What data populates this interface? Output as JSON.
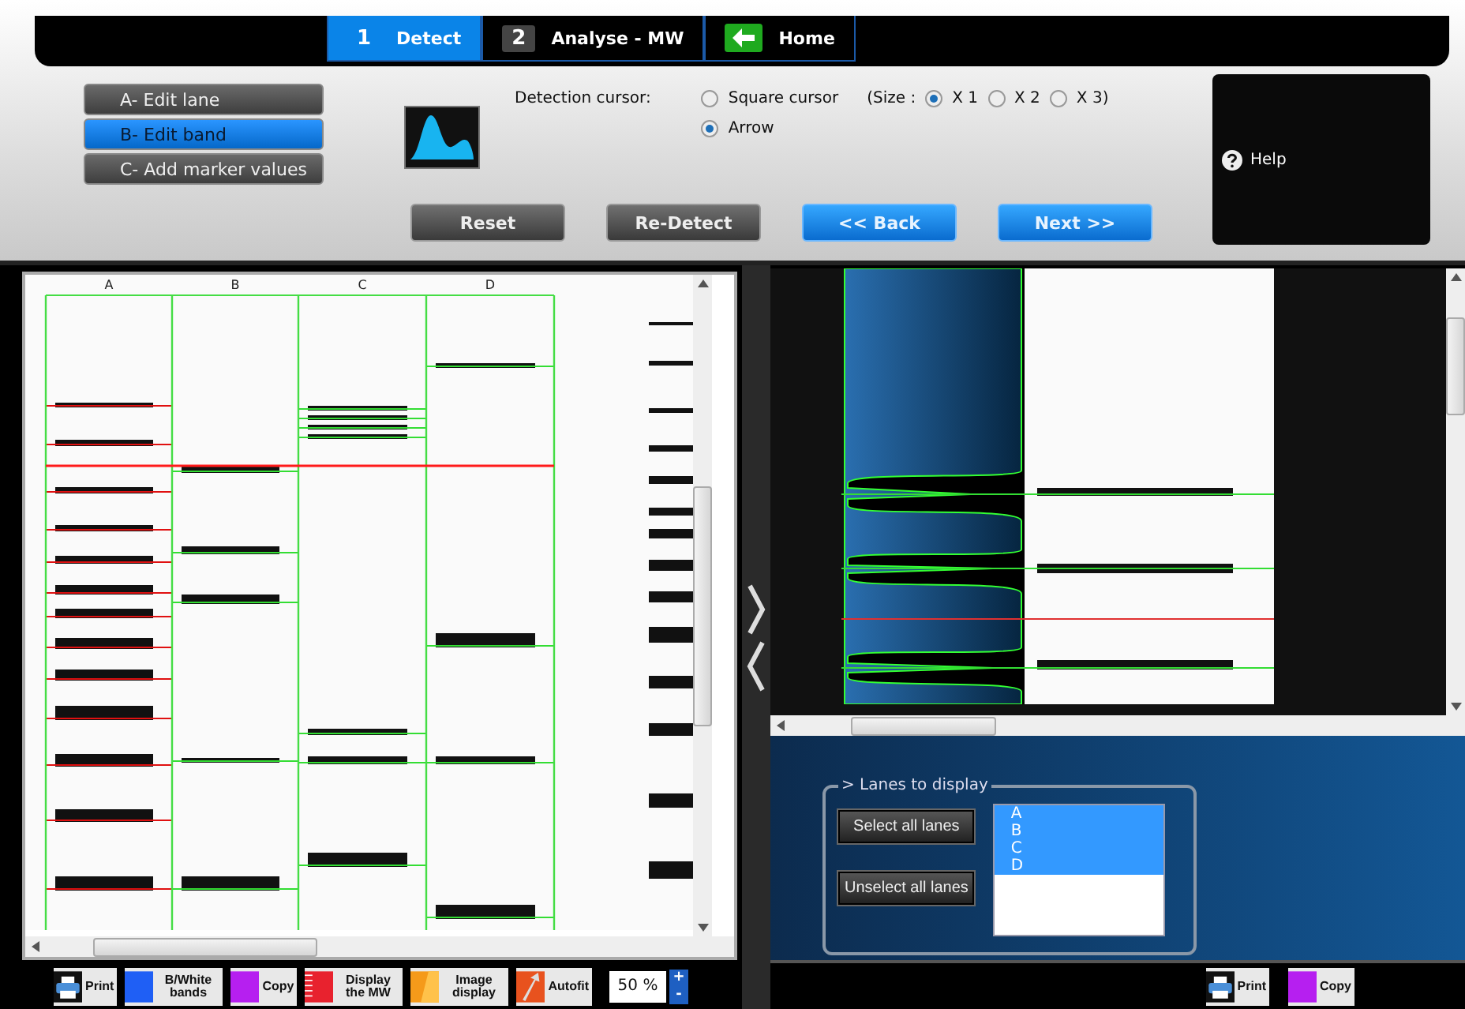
{
  "tabs": [
    {
      "kind": "step",
      "number": "1",
      "label": "Detect",
      "selected": true
    },
    {
      "kind": "step",
      "number": "2",
      "label": "Analyse - MW",
      "selected": false
    },
    {
      "kind": "home",
      "label": "Home",
      "selected": false
    }
  ],
  "modes": [
    {
      "label": "A- Edit lane",
      "selected": false
    },
    {
      "label": "B- Edit band",
      "selected": true
    },
    {
      "label": "C- Add marker values",
      "selected": false
    }
  ],
  "detection": {
    "label": "Detection cursor:",
    "cursors": [
      {
        "label": "Square cursor",
        "selected": false
      },
      {
        "label": "Arrow",
        "selected": true
      }
    ],
    "size_label": "(Size :",
    "sizes": [
      {
        "label": "X 1",
        "selected": true
      },
      {
        "label": "X 2",
        "selected": false
      },
      {
        "label": "X 3)",
        "selected": false
      }
    ]
  },
  "actions": [
    {
      "kind": "gray",
      "label": "Reset"
    },
    {
      "kind": "gray",
      "label": "Re-Detect"
    },
    {
      "kind": "blue",
      "label": "<< Back"
    },
    {
      "kind": "blue",
      "label": "Next >>"
    }
  ],
  "help": "Help",
  "gel": {
    "lanes": [
      "A",
      "B",
      "C",
      "D"
    ]
  },
  "left_toolbar": {
    "tools": [
      {
        "kind": "print",
        "label": "Print"
      },
      {
        "kind": "bw",
        "label": "B/White bands"
      },
      {
        "kind": "copy",
        "label": "Copy"
      },
      {
        "kind": "mw",
        "label": "Display the MW"
      },
      {
        "kind": "image",
        "label": "Image display"
      },
      {
        "kind": "autofit",
        "label": "Autofit"
      }
    ],
    "zoom": "50 %",
    "zoom_in": "+",
    "zoom_out": "-"
  },
  "lanes_panel": {
    "title": "> Lanes to display",
    "select_all": "Select all lanes",
    "unselect_all": "Unselect all lanes",
    "lanes": [
      {
        "label": "A",
        "selected": true
      },
      {
        "label": "B",
        "selected": true
      },
      {
        "label": "C",
        "selected": true
      },
      {
        "label": "D",
        "selected": true
      }
    ]
  },
  "right_toolbar": {
    "tools": [
      {
        "kind": "print",
        "label": "Print"
      },
      {
        "kind": "copy",
        "label": "Copy"
      }
    ]
  }
}
